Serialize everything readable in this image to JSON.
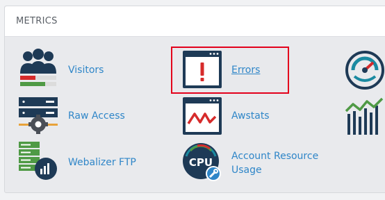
{
  "panel": {
    "title": "METRICS"
  },
  "items": [
    {
      "label": "Visitors",
      "icon": "visitors-icon"
    },
    {
      "label": "Errors",
      "icon": "errors-icon"
    },
    {
      "label": "Raw Access",
      "icon": "raw-access-icon"
    },
    {
      "label": "Awstats",
      "icon": "awstats-icon"
    },
    {
      "label": "Webalizer FTP",
      "icon": "webalizer-ftp-icon"
    },
    {
      "label": "Account Resource\nUsage",
      "label_line1": "Account Resource",
      "label_line2": "Usage",
      "icon": "cpu-icon"
    }
  ],
  "colors": {
    "icon_navy": "#1e3a56",
    "icon_teal": "#1a8aa1",
    "icon_red": "#d62b2b",
    "icon_green": "#4f9a45",
    "link_blue": "#2f86c8",
    "highlight_red": "#e3001b"
  }
}
